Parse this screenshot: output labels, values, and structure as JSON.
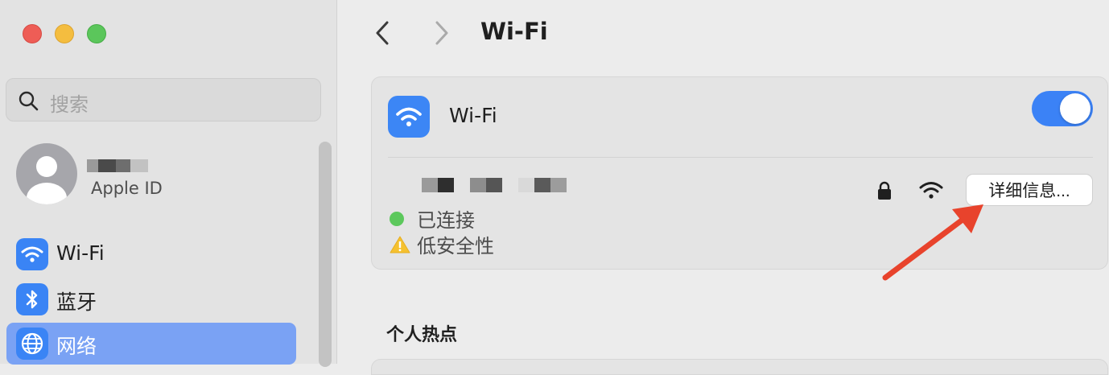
{
  "sidebar": {
    "search_placeholder": "搜索",
    "account": {
      "name_redacted": true,
      "subtitle": "Apple ID"
    },
    "items": [
      {
        "label": "Wi-Fi",
        "icon": "wifi-icon",
        "selected": false
      },
      {
        "label": "蓝牙",
        "icon": "bluetooth-icon",
        "selected": false
      },
      {
        "label": "网络",
        "icon": "globe-icon",
        "selected": true
      }
    ]
  },
  "header": {
    "title": "Wi-Fi"
  },
  "wifi_card": {
    "title": "Wi-Fi",
    "toggle_on": true,
    "network": {
      "name_redacted": true,
      "status": "已连接",
      "security_warning": "低安全性",
      "details_button": "详细信息..."
    }
  },
  "sections": {
    "hotspot_title": "个人热点"
  },
  "colors": {
    "accent": "#3b82f6",
    "selected_sidebar": "#7aa2f4",
    "connected_dot": "#5cc85c",
    "annotation_arrow": "#e8432c"
  }
}
